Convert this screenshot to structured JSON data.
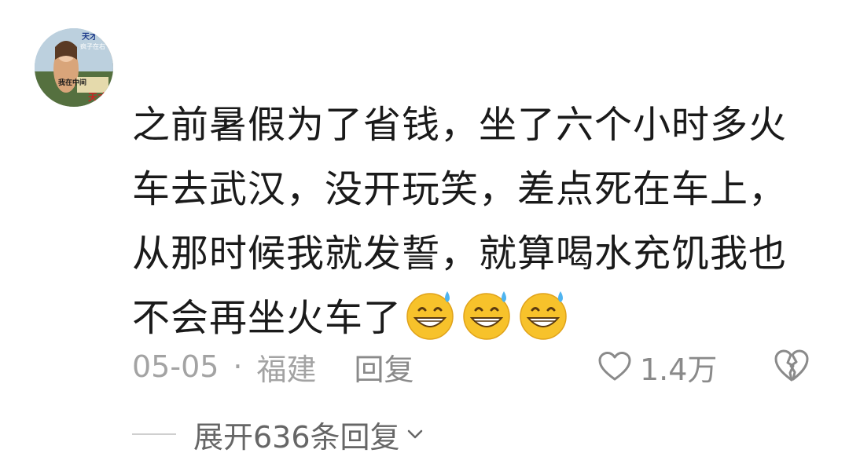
{
  "comment": {
    "avatar_text": [
      "天才",
      "疯子在右",
      "我在中间",
      "天才"
    ],
    "text": "之前暑假为了省钱，坐了六个小时多火车去武汉，没开玩笑，差点死在车上，从那时候我就发誓，就算喝水充饥我也不会再坐火车了",
    "emojis": [
      "grinning-sweat-emoji",
      "grinning-sweat-emoji",
      "grinning-sweat-emoji"
    ],
    "date": "05-05",
    "separator": "·",
    "location": "福建",
    "reply_label": "回复",
    "like_count": "1.4万",
    "expand_label": "展开636条回复"
  },
  "icons": {
    "like": "heart-outline-icon",
    "dislike": "broken-heart-icon",
    "expand": "chevron-down-icon"
  },
  "colors": {
    "text": "#1a1a1a",
    "meta": "#a3a3a3",
    "action": "#8a8a8a"
  }
}
